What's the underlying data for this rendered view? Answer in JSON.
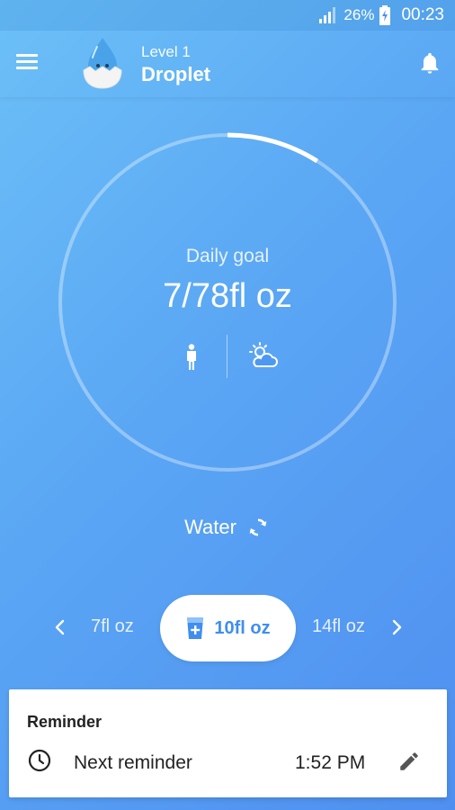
{
  "status_bar": {
    "battery_percent": "26%",
    "time": "00:23",
    "icons": [
      "signal-icon",
      "battery-charging-icon"
    ]
  },
  "app_bar": {
    "level_label": "Level 1",
    "level_name": "Droplet",
    "icons": [
      "menu-icon",
      "droplet-egg-avatar-icon",
      "bell-icon"
    ]
  },
  "goal": {
    "label": "Daily goal",
    "value": "7/78fl oz",
    "progress_fraction": 0.09,
    "icons": [
      "person-icon",
      "sun-cloud-weather-icon"
    ]
  },
  "drink": {
    "type_label": "Water",
    "icon": "swap-icon"
  },
  "cups": {
    "prev": "7fl oz",
    "selected": "10fl oz",
    "next": "14fl oz",
    "icons": [
      "chevron-left-icon",
      "cup-add-icon",
      "chevron-right-icon"
    ]
  },
  "reminder": {
    "title": "Reminder",
    "next_label": "Next reminder",
    "next_time": "1:52 PM",
    "icons": [
      "clock-icon",
      "edit-pencil-icon"
    ]
  },
  "colors": {
    "background_start": "#6cc0f7",
    "background_end": "#4f8ff0",
    "accent": "#3f8ef0",
    "card": "#ffffff"
  }
}
